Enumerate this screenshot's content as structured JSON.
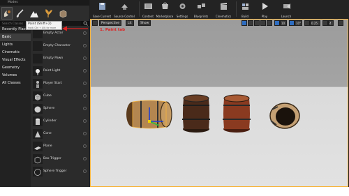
{
  "modes_panel": {
    "title": "Modes",
    "tabs": [
      {
        "name": "place-mode",
        "active": true
      },
      {
        "name": "paint-mode",
        "active": false
      },
      {
        "name": "landscape-mode",
        "active": false
      },
      {
        "name": "foliage-mode",
        "active": false
      },
      {
        "name": "geometry-mode",
        "active": false
      }
    ],
    "tooltip": {
      "title": "Paint (Shift+2)",
      "hint": "Hold (Ctrl + Alt) for more"
    },
    "search_placeholder": "Search Classes",
    "categories": [
      "Recently Placed",
      "Basic",
      "Lights",
      "Cinematic",
      "Visual Effects",
      "Geometry",
      "Volumes",
      "All Classes"
    ],
    "selected_category": "Basic",
    "items": [
      "Empty Actor",
      "Empty Character",
      "Empty Pawn",
      "Point Light",
      "Player Start",
      "Cube",
      "Sphere",
      "Cylinder",
      "Cone",
      "Plane",
      "Box Trigger",
      "Sphere Trigger"
    ]
  },
  "toolbar": {
    "buttons": [
      {
        "label": "Save Current",
        "icon": "save-icon"
      },
      {
        "label": "Source Control",
        "icon": "source-control-icon"
      },
      {
        "label": "Content",
        "icon": "content-icon"
      },
      {
        "label": "Marketplace",
        "icon": "marketplace-icon"
      },
      {
        "label": "Settings",
        "icon": "settings-icon"
      },
      {
        "label": "Blueprints",
        "icon": "blueprints-icon"
      },
      {
        "label": "Cinematics",
        "icon": "cinematics-icon"
      },
      {
        "label": "Build",
        "icon": "build-icon"
      },
      {
        "label": "Play",
        "icon": "play-icon"
      },
      {
        "label": "Launch",
        "icon": "launch-icon"
      }
    ]
  },
  "viewport": {
    "perspective_label": "Perspective",
    "lit_label": "Lit",
    "show_label": "Show",
    "grid_snap": "10",
    "rotation_snap": "10°",
    "scale_snap": "0.25",
    "camera_speed": "4",
    "annotation": "1. Paint tab"
  },
  "colors": {
    "accent": "#f7b43b",
    "annotation": "#dd2222",
    "selection": "#2e6cbf"
  }
}
